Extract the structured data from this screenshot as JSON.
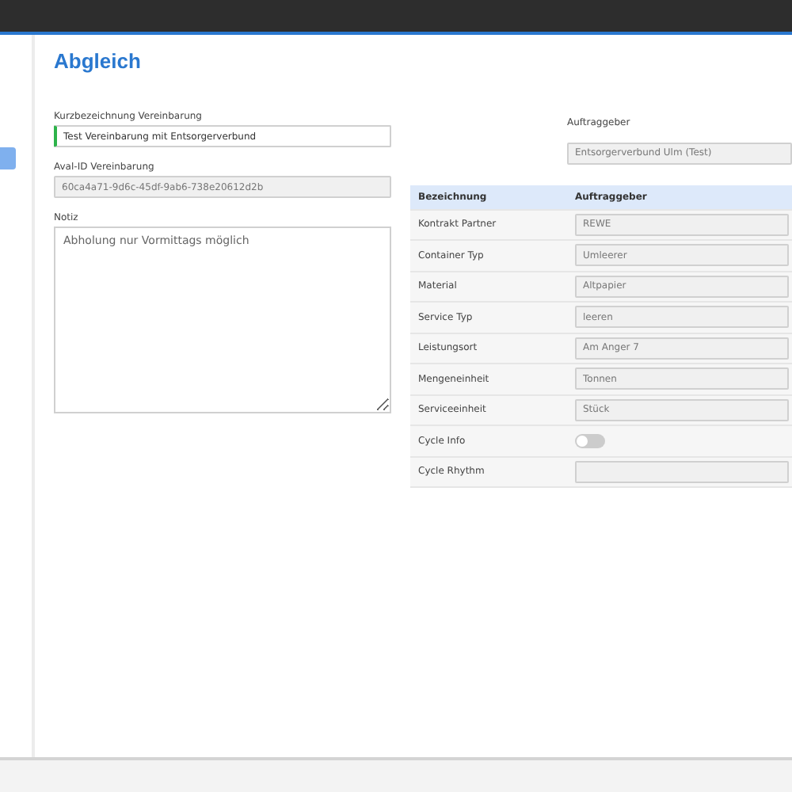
{
  "page": {
    "title": "Abgleich"
  },
  "form": {
    "short_name": {
      "label": "Kurzbezeichnung Vereinbarung",
      "value": "Test Vereinbarung mit Entsorgerverbund",
      "valid": true
    },
    "aval_id": {
      "label": "Aval-ID Vereinbarung",
      "value": "60ca4a71-9d6c-45df-9ab6-738e20612d2b",
      "disabled": true
    },
    "note": {
      "label": "Notiz",
      "placeholder": "Abholung nur Vormittags möglich"
    }
  },
  "client": {
    "label": "Auftraggeber",
    "value": "Entsorgerverbund Ulm (Test)",
    "disabled": true
  },
  "table": {
    "columns": [
      "Bezeichnung",
      "Auftraggeber"
    ],
    "rows": [
      {
        "label": "Kontrakt Partner",
        "kind": "field",
        "value": "REWE"
      },
      {
        "label": "Container Typ",
        "kind": "field",
        "value": "Umleerer"
      },
      {
        "label": "Material",
        "kind": "field",
        "value": "Altpapier"
      },
      {
        "label": "Service Typ",
        "kind": "field",
        "value": "leeren"
      },
      {
        "label": "Leistungsort",
        "kind": "field",
        "value": "Am Anger 7"
      },
      {
        "label": "Mengeneinheit",
        "kind": "field",
        "value": "Tonnen"
      },
      {
        "label": "Serviceeinheit",
        "kind": "field",
        "value": "Stück"
      },
      {
        "label": "Cycle Info",
        "kind": "toggle",
        "on": false
      },
      {
        "label": "Cycle Rhythm",
        "kind": "field",
        "value": ""
      }
    ]
  }
}
